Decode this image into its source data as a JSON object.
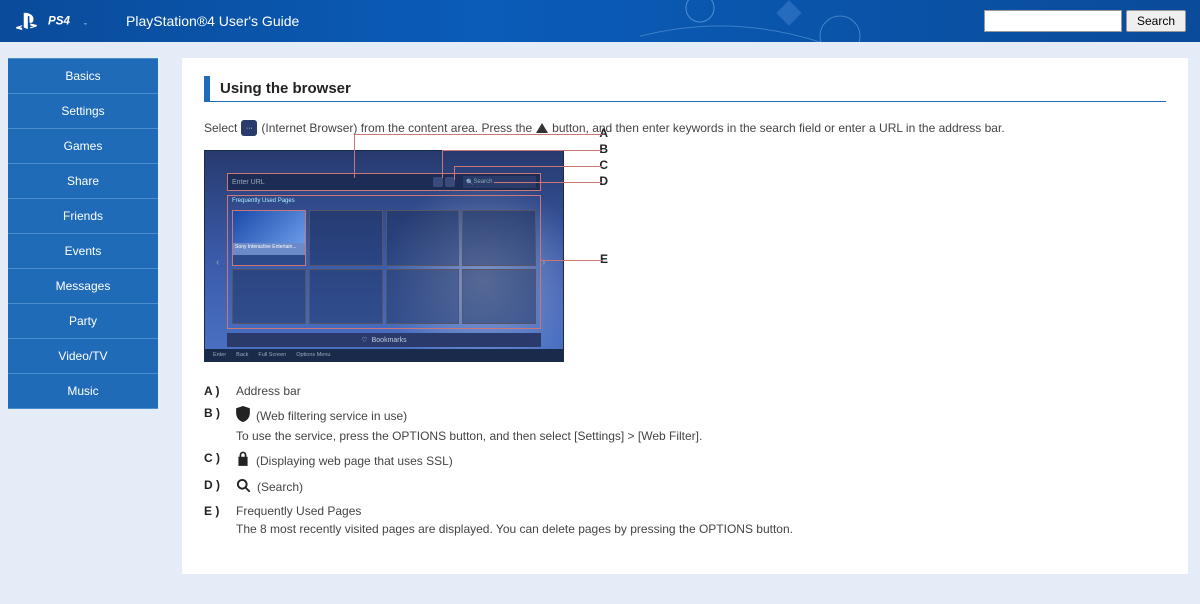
{
  "header": {
    "title": "PlayStation®4 User's Guide",
    "logo_ps4": "PS4",
    "search_button": "Search",
    "search_placeholder": ""
  },
  "sidebar": {
    "items": [
      {
        "label": "Basics"
      },
      {
        "label": "Settings"
      },
      {
        "label": "Games"
      },
      {
        "label": "Share"
      },
      {
        "label": "Friends"
      },
      {
        "label": "Events"
      },
      {
        "label": "Messages"
      },
      {
        "label": "Party"
      },
      {
        "label": "Video/TV"
      },
      {
        "label": "Music"
      }
    ]
  },
  "content": {
    "heading": "Using the browser",
    "intro_part1": "Select",
    "intro_part2": "(Internet Browser) from the content area. Press the",
    "intro_part3": "button, and then enter keywords in the search field or enter a URL in the address bar."
  },
  "diagram": {
    "labels": [
      "A",
      "B",
      "C",
      "D",
      "E"
    ],
    "enter_url": "Enter URL",
    "search_hint": "Search",
    "freq_label": "Frequently Used Pages",
    "tile_caption": "Sony Interactive Entertain...",
    "bookmarks": "Bookmarks",
    "hints": [
      "Enter",
      "Back",
      "Full Screen",
      "Options Menu"
    ]
  },
  "legend": {
    "A": {
      "key": "A )",
      "text": "Address bar"
    },
    "B": {
      "key": "B )",
      "text": "(Web filtering service in use)",
      "sub": "To use the service, press the OPTIONS button, and then select [Settings] > [Web Filter]."
    },
    "C": {
      "key": "C )",
      "text": "(Displaying web page that uses SSL)"
    },
    "D": {
      "key": "D )",
      "text": "(Search)"
    },
    "E": {
      "key": "E )",
      "text": "Frequently Used Pages",
      "sub": "The 8 most recently visited pages are displayed. You can delete pages by pressing the OPTIONS button."
    }
  }
}
